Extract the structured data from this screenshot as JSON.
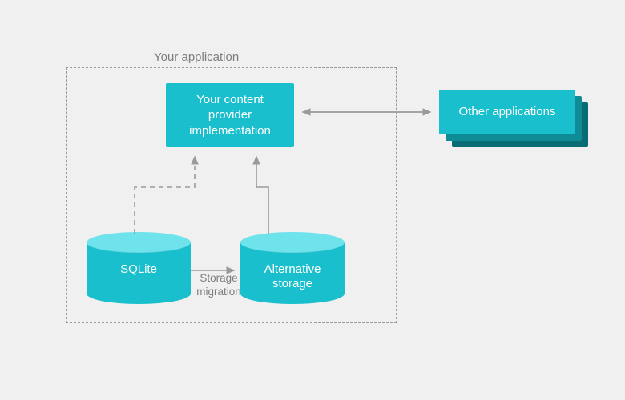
{
  "diagram": {
    "container_label": "Your application",
    "provider_box": "Your content\nprovider\nimplementation",
    "other_apps": "Other applications",
    "sqlite": "SQLite",
    "alt_storage": "Alternative\nstorage",
    "migration_label": "Storage\nmigration"
  },
  "colors": {
    "accent": "#19bfcc",
    "accent_light": "#6fe3ec",
    "arrow": "#9a9a9a",
    "bg": "#f0f0f0"
  }
}
